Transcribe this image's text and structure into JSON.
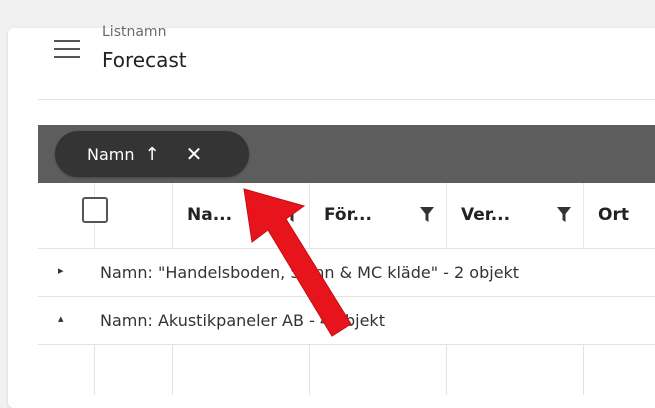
{
  "header": {
    "subtitle": "Listnamn",
    "title": "Forecast",
    "menu_icon": "hamburger-menu-icon"
  },
  "group_chip": {
    "label": "Namn",
    "sort_arrow": "↑",
    "close": "✕"
  },
  "columns": [
    {
      "label": "Na...",
      "filter_icon": "filter-icon"
    },
    {
      "label": "För...",
      "filter_icon": "filter-icon"
    },
    {
      "label": "Ver...",
      "filter_icon": "filter-icon"
    },
    {
      "label": "Ort",
      "filter_icon": ""
    }
  ],
  "groups": [
    {
      "toggle": "▸",
      "text": "Namn: \"Handelsboden, Skinn & MC kläde\" - 2 objekt",
      "expanded": false
    },
    {
      "toggle": "▴",
      "text": "Namn: Akustikpaneler AB - 4 objekt",
      "expanded": true
    }
  ],
  "colors": {
    "group_bar": "#5d5d5d",
    "chip": "#343434",
    "annotation_arrow": "#e8141b"
  }
}
